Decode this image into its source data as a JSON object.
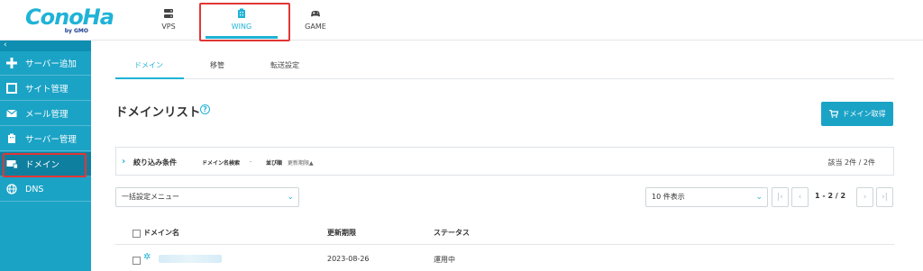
{
  "brand": {
    "logo_text": "ConoHa",
    "logo_sub": "by GMO"
  },
  "top_nav": [
    {
      "label": "VPS",
      "icon": "server-icon"
    },
    {
      "label": "WING",
      "icon": "building-icon",
      "active": true
    },
    {
      "label": "GAME",
      "icon": "gamepad-icon"
    }
  ],
  "sidebar": {
    "collapse_glyph": "‹",
    "items": [
      {
        "label": "サーバー追加",
        "icon": "plus-icon"
      },
      {
        "label": "サイト管理",
        "icon": "window-icon"
      },
      {
        "label": "メール管理",
        "icon": "mail-icon"
      },
      {
        "label": "サーバー管理",
        "icon": "server-building-icon"
      },
      {
        "label": "ドメイン",
        "icon": "domain-icon",
        "active": true
      },
      {
        "label": "DNS",
        "icon": "globe-icon"
      }
    ]
  },
  "subtabs": [
    {
      "label": "ドメイン",
      "active": true
    },
    {
      "label": "移管"
    },
    {
      "label": "転送設定"
    }
  ],
  "page": {
    "title": "ドメインリスト",
    "help": "?"
  },
  "buy_button": {
    "label": "ドメイン取得"
  },
  "filter": {
    "title": "絞り込み条件",
    "search_label": "ドメイン名検索",
    "search_value": "-",
    "sort_label": "並び順",
    "sort_value": "更新期限▲",
    "count": "該当 2件 / 2件"
  },
  "bulk_select": {
    "value": "一括設定メニュー"
  },
  "per_page_select": {
    "value": "10 件表示"
  },
  "pagination": {
    "info": "1 - 2 / 2"
  },
  "table": {
    "columns": [
      "ドメイン名",
      "更新期限",
      "ステータス"
    ],
    "rows": [
      {
        "domain": "",
        "expiry": "2023-08-26",
        "status": "運用中"
      }
    ]
  },
  "colors": {
    "accent": "#1fb3d6",
    "sidebar": "#1ba3c6",
    "highlight_box": "#e23636"
  }
}
